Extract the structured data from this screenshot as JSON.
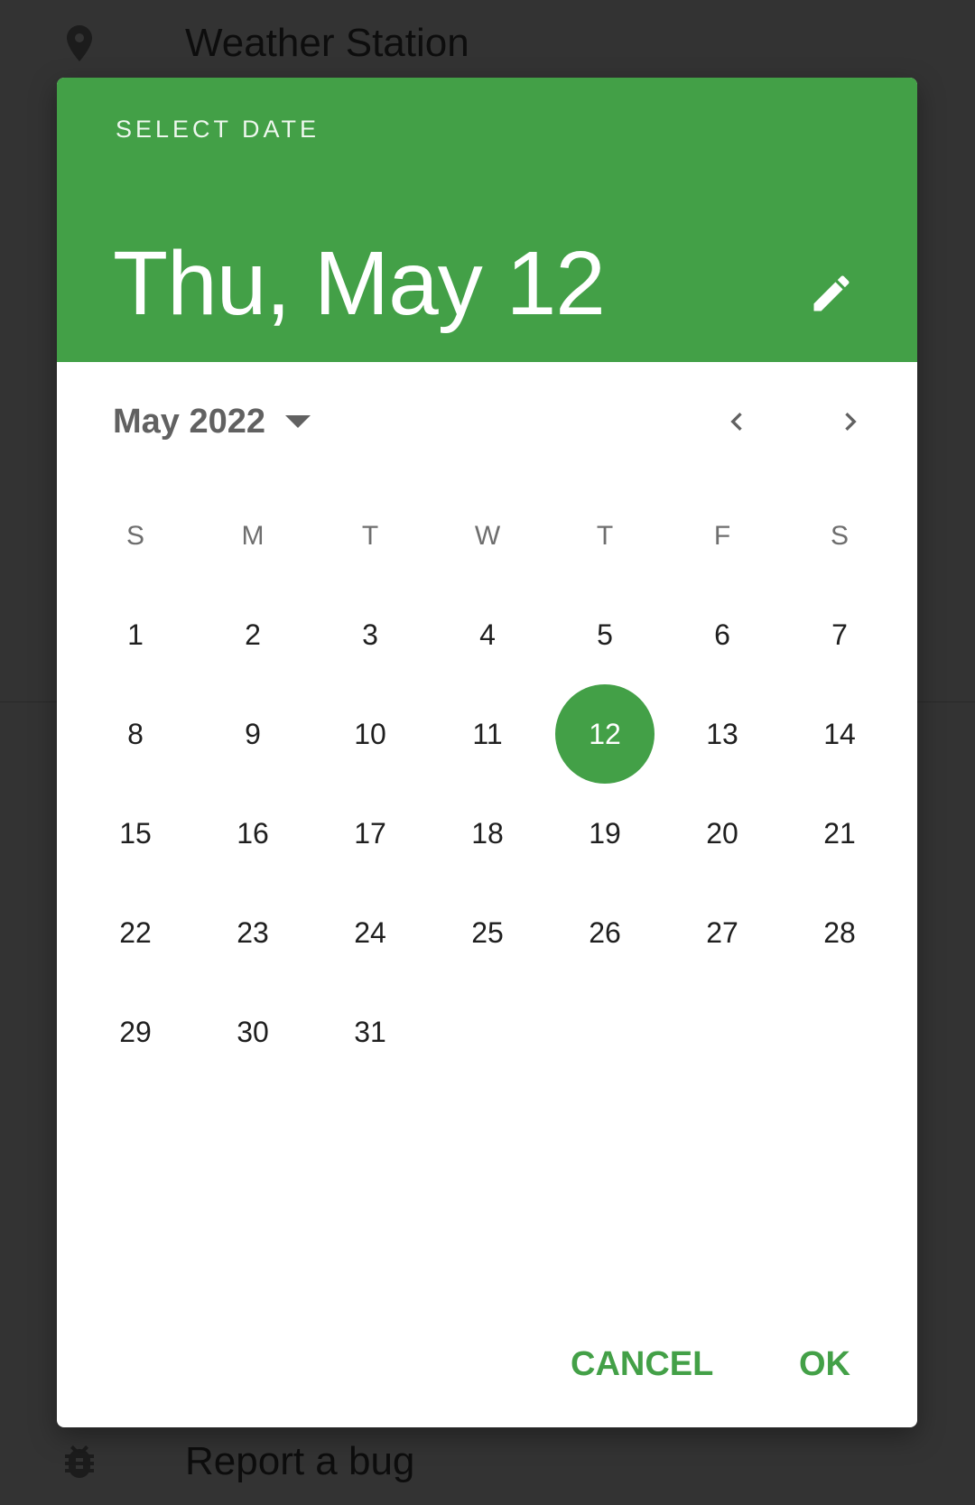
{
  "background": {
    "items": [
      {
        "label": "Weather Station",
        "icon": "location-pin-icon"
      },
      {
        "label": "Report a bug",
        "icon": "bug-icon"
      }
    ]
  },
  "dialog": {
    "overline": "SELECT DATE",
    "selected_date_text": "Thu, May 12",
    "edit_icon": "pencil-icon",
    "month_year": "May 2022",
    "prev_icon": "chevron-left-icon",
    "next_icon": "chevron-right-icon",
    "weekdays": [
      "S",
      "M",
      "T",
      "W",
      "T",
      "F",
      "S"
    ],
    "first_weekday_index": 0,
    "days_in_month": 31,
    "selected_day": 12,
    "days": [
      "1",
      "2",
      "3",
      "4",
      "5",
      "6",
      "7",
      "8",
      "9",
      "10",
      "11",
      "12",
      "13",
      "14",
      "15",
      "16",
      "17",
      "18",
      "19",
      "20",
      "21",
      "22",
      "23",
      "24",
      "25",
      "26",
      "27",
      "28",
      "29",
      "30",
      "31"
    ],
    "cancel_label": "CANCEL",
    "ok_label": "OK",
    "accent_color": "#43A047"
  }
}
